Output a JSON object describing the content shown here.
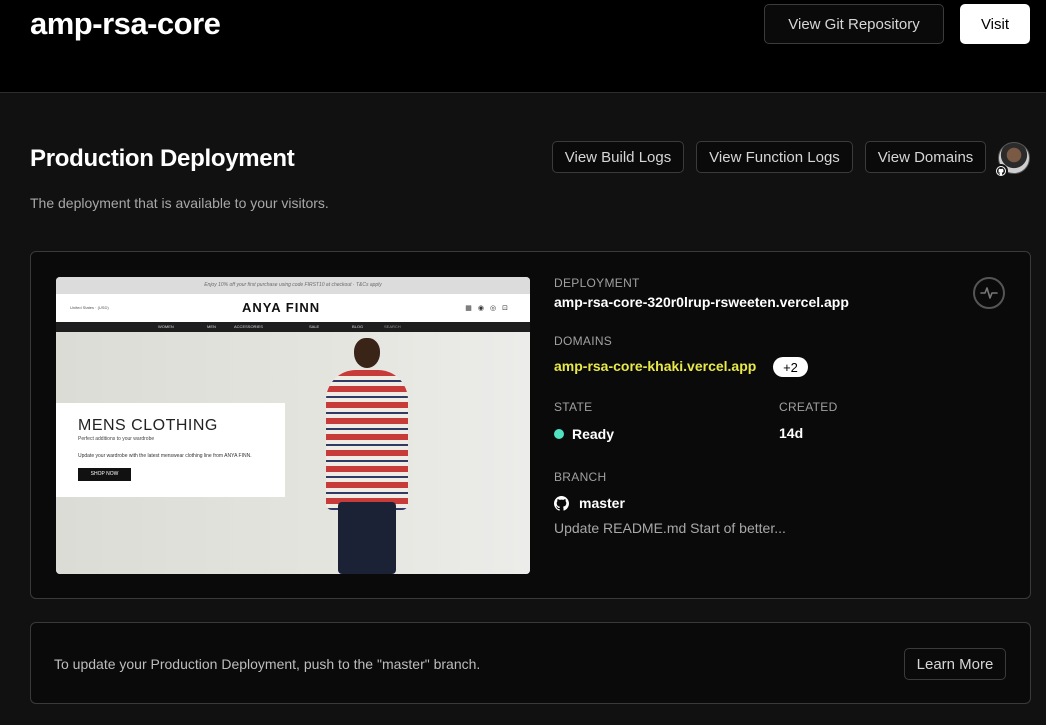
{
  "header": {
    "project_name": "amp-rsa-core",
    "view_git_label": "View Git Repository",
    "visit_label": "Visit"
  },
  "production": {
    "title": "Production Deployment",
    "subtitle": "The deployment that is available to your visitors.",
    "view_build_logs_label": "View Build Logs",
    "view_function_logs_label": "View Function Logs",
    "view_domains_label": "View Domains"
  },
  "preview": {
    "promo": "Enjoy 10% off your first purchase using code FIRST10 at checkout · T&Cs apply",
    "region": "United States · (USD)",
    "logo": "ANYA FINN",
    "nav": [
      "WOMEN",
      "MEN",
      "ACCESSORIES",
      "SALE",
      "BLOG",
      "SEARCH"
    ],
    "hero_title": "MENS CLOTHING",
    "hero_subtitle": "Perfect additions to your wardrobe",
    "hero_text": "Update your wardrobe with the latest menswear clothing line from ANYA FINN.",
    "shop_button": "SHOP NOW"
  },
  "deployment": {
    "deployment_label": "DEPLOYMENT",
    "deployment_url": "amp-rsa-core-320r0lrup-rsweeten.vercel.app",
    "domains_label": "DOMAINS",
    "domain": "amp-rsa-core-khaki.vercel.app",
    "extra_domains": "+2",
    "state_label": "STATE",
    "state_value": "Ready",
    "state_color": "#50e3c2",
    "created_label": "CREATED",
    "created_value": "14d",
    "branch_label": "BRANCH",
    "branch_name": "master",
    "commit_message": "Update README.md Start of better..."
  },
  "info": {
    "text": "To update your Production Deployment, push to the \"master\" branch.",
    "learn_more_label": "Learn More"
  },
  "colors": {
    "domain_link": "#e8e84a",
    "ready_dot": "#50e3c2"
  }
}
